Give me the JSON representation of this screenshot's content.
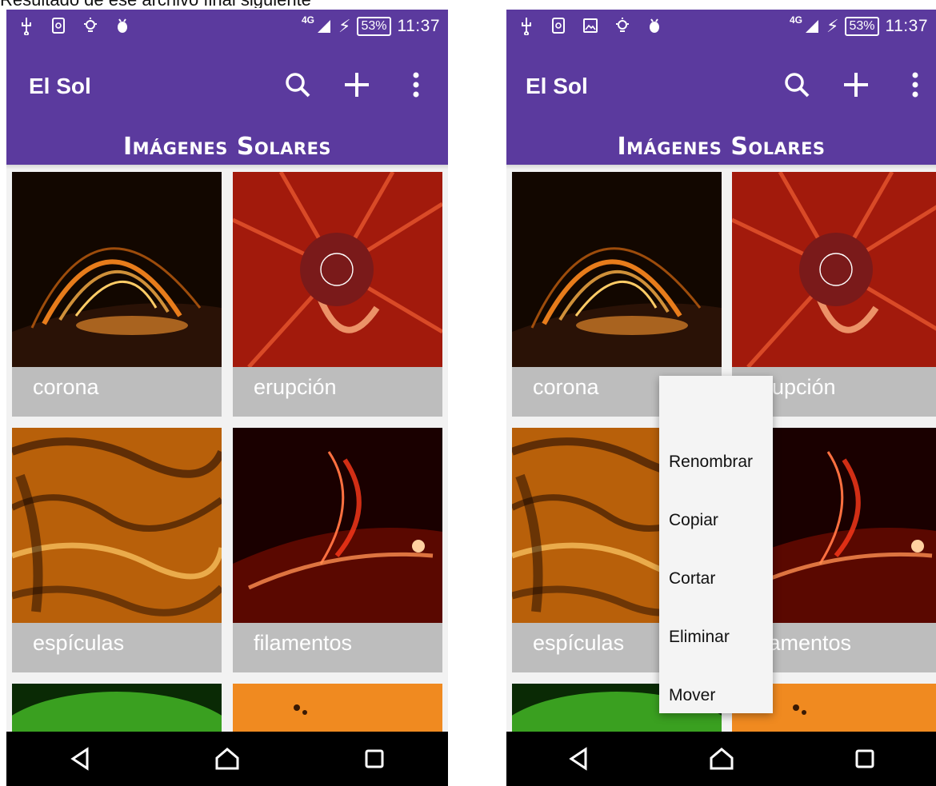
{
  "caption": "Resultado de ese archivo final siguiente",
  "status": {
    "network": "4G",
    "battery": "53%",
    "time": "11:37"
  },
  "app": {
    "title": "El Sol",
    "banner": "Imágenes Solares"
  },
  "tiles": [
    {
      "label": "corona"
    },
    {
      "label": "erupción"
    },
    {
      "label": "espículas"
    },
    {
      "label": "filamentos"
    }
  ],
  "context_menu": {
    "items": [
      "Renombrar",
      "Copiar",
      "Cortar",
      "Eliminar",
      "Mover"
    ]
  },
  "colors": {
    "primary": "#5b3a9e",
    "tile_label_bg": "#bdbdbd",
    "navbar": "#000000"
  }
}
